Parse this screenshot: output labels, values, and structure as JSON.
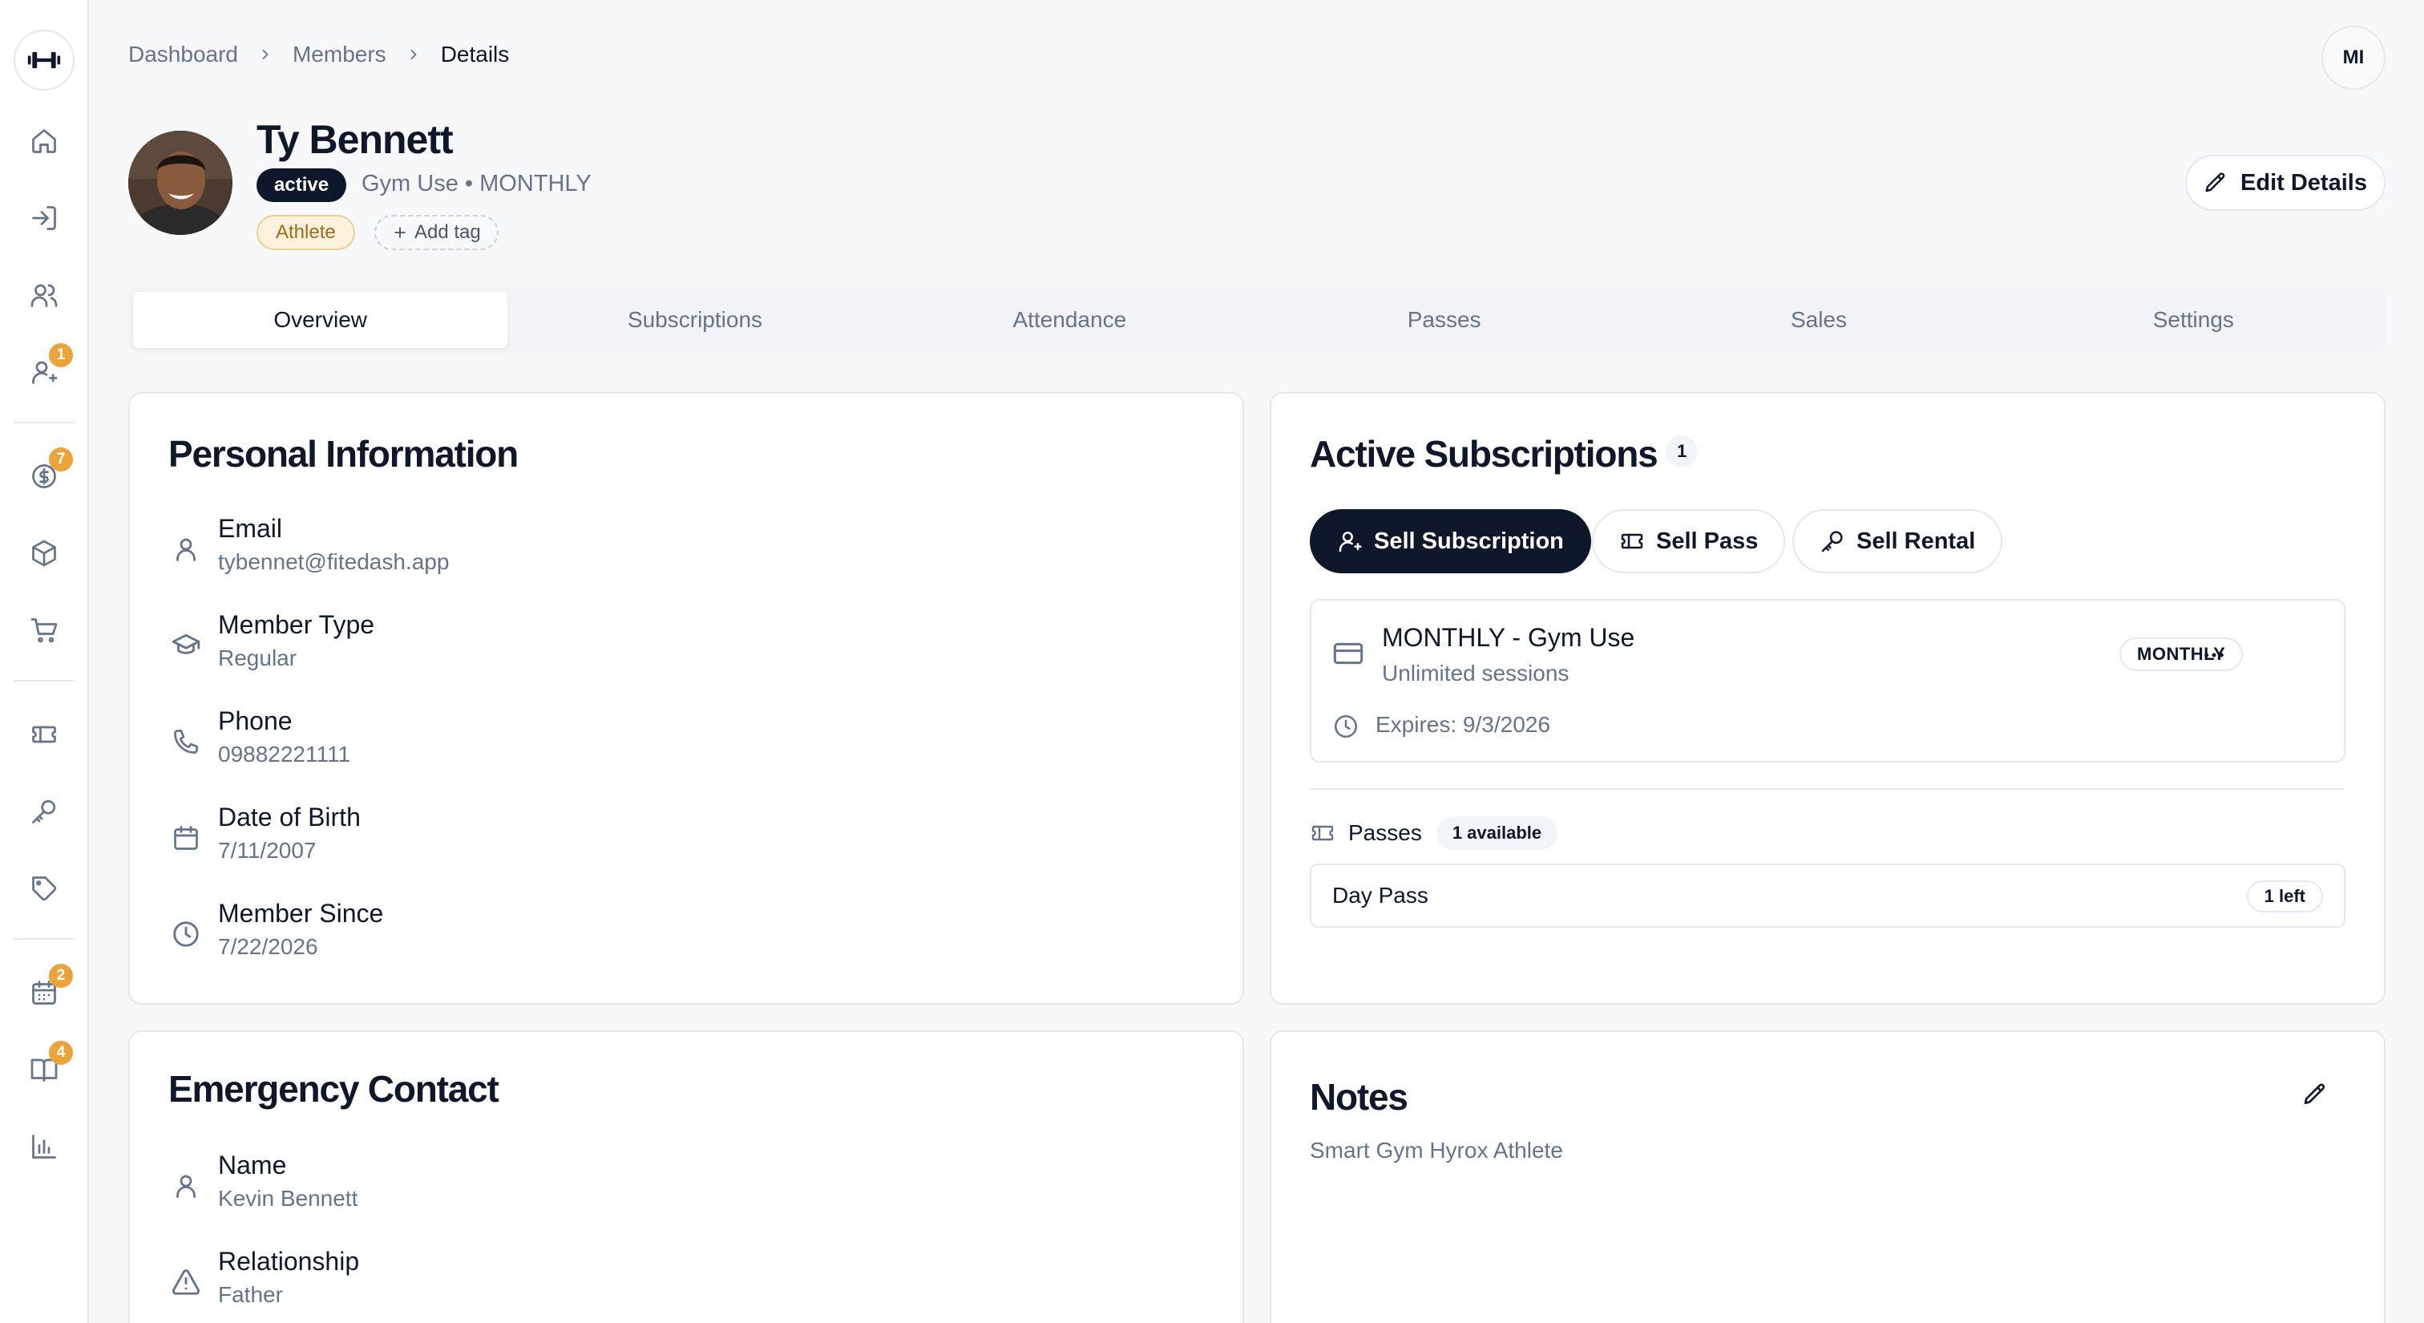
{
  "breadcrumb": {
    "items": [
      "Dashboard",
      "Members"
    ],
    "current": "Details"
  },
  "user": {
    "initials": "MI"
  },
  "sidebar": {
    "items": [
      {
        "icon": "home-icon",
        "badge": ""
      },
      {
        "icon": "check-in-icon",
        "badge": ""
      },
      {
        "icon": "members-icon",
        "badge": ""
      },
      {
        "icon": "user-requests-icon",
        "badge": "1"
      },
      {
        "icon": "payments-icon",
        "badge": "7"
      },
      {
        "icon": "products-icon",
        "badge": ""
      },
      {
        "icon": "cart-icon",
        "badge": ""
      },
      {
        "icon": "ticket-icon",
        "badge": ""
      },
      {
        "icon": "key-icon",
        "badge": ""
      },
      {
        "icon": "tag-icon",
        "badge": ""
      },
      {
        "icon": "calendar-icon",
        "badge": "2"
      },
      {
        "icon": "book-icon",
        "badge": "4"
      },
      {
        "icon": "reports-icon",
        "badge": ""
      }
    ]
  },
  "member": {
    "name": "Ty Bennett",
    "status": "active",
    "plan": "Gym Use • MONTHLY",
    "tags": [
      "Athlete"
    ],
    "add_tag_label": "Add tag",
    "edit_label": "Edit Details"
  },
  "tabs": [
    "Overview",
    "Subscriptions",
    "Attendance",
    "Passes",
    "Sales",
    "Settings"
  ],
  "active_tab": "Overview",
  "personal_info": {
    "title": "Personal Information",
    "rows": [
      {
        "label": "Email",
        "value": "tybennet@fitedash.app",
        "icon": "user-icon"
      },
      {
        "label": "Member Type",
        "value": "Regular",
        "icon": "graduation-cap-icon"
      },
      {
        "label": "Phone",
        "value": "09882221111",
        "icon": "phone-icon"
      },
      {
        "label": "Date of Birth",
        "value": "7/11/2007",
        "icon": "calendar-icon"
      },
      {
        "label": "Member Since",
        "value": "7/22/2026",
        "icon": "clock-icon"
      }
    ]
  },
  "emergency_contact": {
    "title": "Emergency Contact",
    "rows": [
      {
        "label": "Name",
        "value": "Kevin Bennett",
        "icon": "user-icon"
      },
      {
        "label": "Relationship",
        "value": "Father",
        "icon": "alert-triangle-icon"
      }
    ]
  },
  "active_subscriptions": {
    "title": "Active Subscriptions",
    "count": "1",
    "actions": [
      "Sell Subscription",
      "Sell Pass",
      "Sell Rental"
    ],
    "subscription": {
      "title": "MONTHLY - Gym Use",
      "description": "Unlimited sessions",
      "expires": "Expires: 9/3/2026",
      "badge": "MONTHLY"
    },
    "passes": {
      "label": "Passes",
      "available": "1 available",
      "items": [
        {
          "name": "Day Pass",
          "left": "1 left"
        }
      ]
    }
  },
  "notes": {
    "title": "Notes",
    "text": "Smart Gym Hyrox Athlete"
  }
}
